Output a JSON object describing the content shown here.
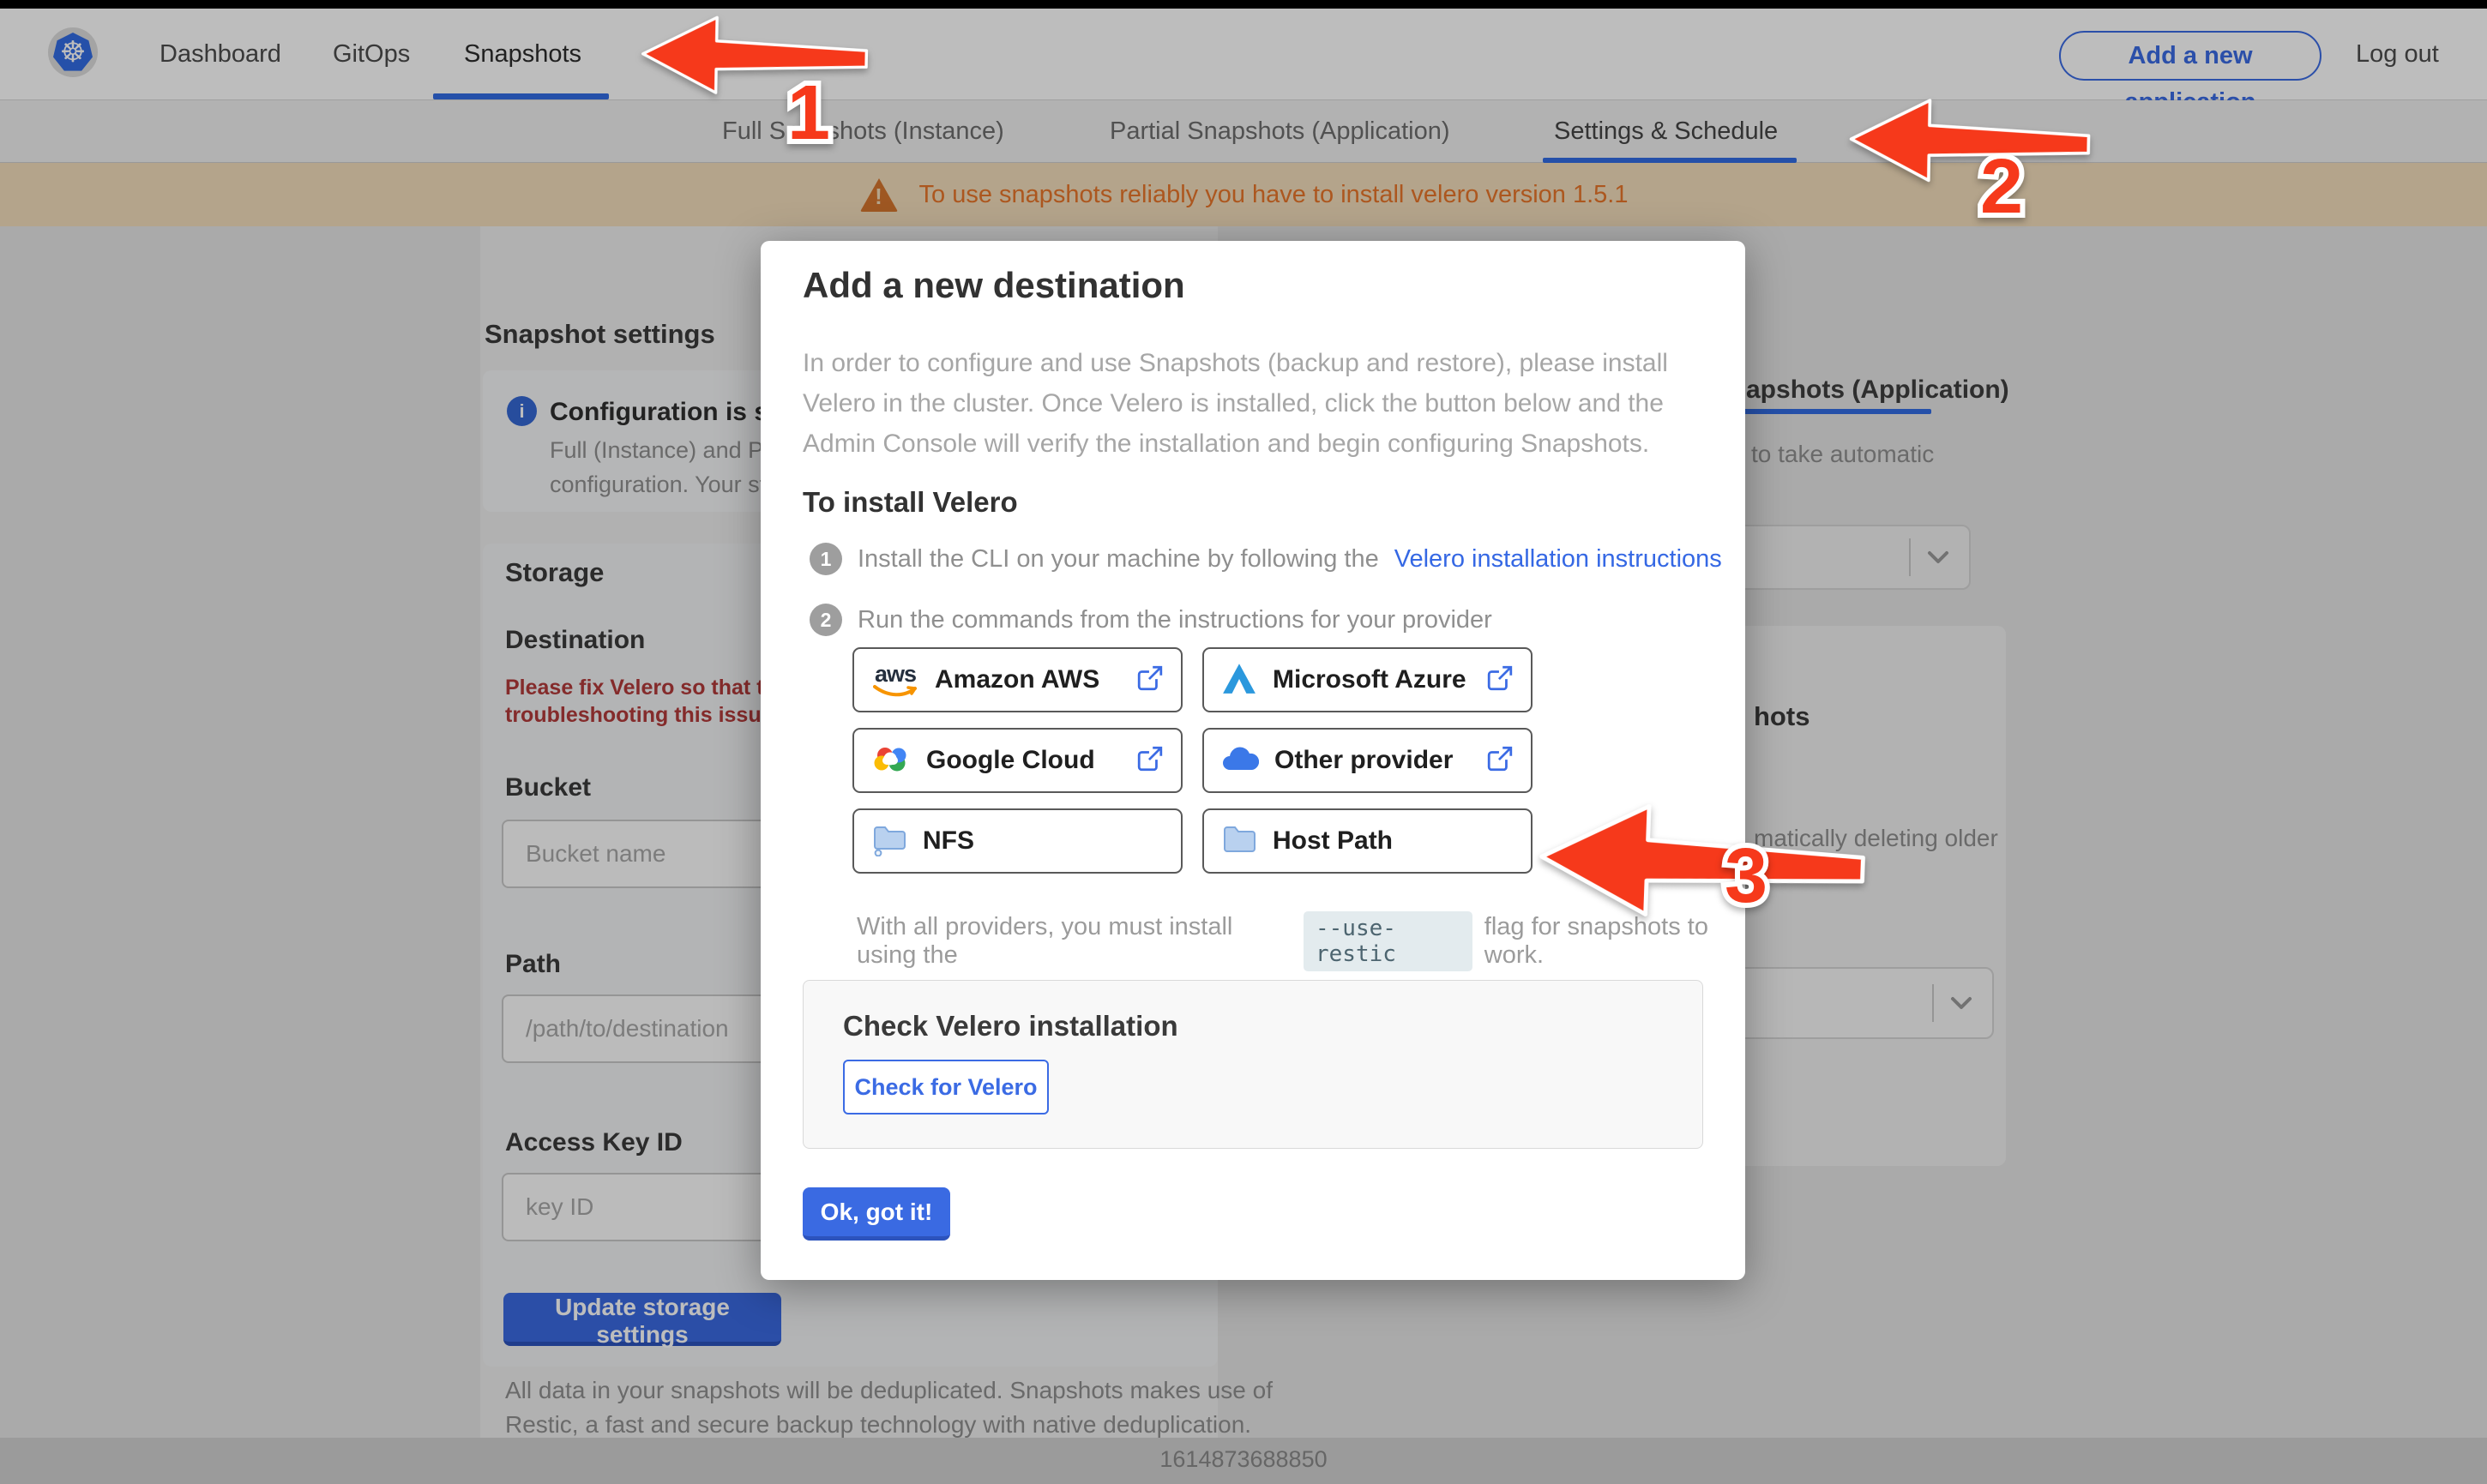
{
  "topnav": {
    "items": [
      "Dashboard",
      "GitOps",
      "Snapshots"
    ],
    "add_application": "Add a new application",
    "logout": "Log out"
  },
  "tabs": [
    "Full Snapshots (Instance)",
    "Partial Snapshots (Application)",
    "Settings & Schedule"
  ],
  "banner": {
    "text": "To use snapshots reliably you have to install velero version 1.5.1"
  },
  "settings_page": {
    "title": "Snapshot settings",
    "config_card": {
      "title": "Configuration is sh",
      "line1": "Full (Instance) and Parti",
      "line2": "configuration. Your stor"
    },
    "storage_title": "Storage",
    "destination_title": "Destination",
    "error_line1": "Please fix Velero so that th",
    "error_line2": "troubleshooting this issue",
    "bucket_label": "Bucket",
    "bucket_placeholder": "Bucket name",
    "path_label": "Path",
    "path_placeholder": "/path/to/destination",
    "access_key_label": "Access Key ID",
    "access_key_placeholder": "key ID",
    "update_button": "Update storage settings",
    "dedup_line1": "All data in your snapshots will be deduplicated. Snapshots makes use of",
    "dedup_line2": "Restic, a fast and secure backup technology with native deduplication.",
    "right_panel": {
      "tab_partial": "apshots (Application)",
      "auto_text": "to take automatic",
      "retention_title": "hots",
      "deleting_text": "matically deleting older"
    }
  },
  "modal": {
    "title": "Add a new destination",
    "description_line1": "In order to configure and use Snapshots (backup and restore), please install",
    "description_line2": "Velero in the cluster. Once Velero is installed, click the button below and the",
    "description_line3": "Admin Console will verify the installation and begin configuring Snapshots.",
    "install_heading": "To install Velero",
    "step1_number": "1",
    "step1_text": "Install the CLI on your machine by following the",
    "step1_link": "Velero installation instructions",
    "step2_number": "2",
    "step2_text": "Run the commands from the instructions for your provider",
    "providers": [
      {
        "label": "Amazon AWS"
      },
      {
        "label": "Microsoft Azure"
      },
      {
        "label": "Google Cloud"
      },
      {
        "label": "Other provider"
      },
      {
        "label": "NFS"
      },
      {
        "label": "Host Path"
      }
    ],
    "restic_prefix": "With all providers, you must install using the",
    "restic_code": "--use-restic",
    "restic_suffix": "flag for snapshots to work.",
    "check_title": "Check Velero installation",
    "check_button": "Check for Velero",
    "ok_button": "Ok, got it!"
  },
  "annotations": {
    "arrow1_label": "1",
    "arrow2_label": "2",
    "arrow3_label": "3"
  },
  "footer": {
    "timestamp": "1614873688850"
  },
  "icons": {
    "k8s_wheel": "☸",
    "info": "i",
    "warning": "!",
    "aws_text": "aws"
  },
  "colors": {
    "accent_blue": "#326ce5",
    "arrow_red": "#f6391b",
    "warning_orange": "#e9762a",
    "error_red": "#b23a3a"
  }
}
